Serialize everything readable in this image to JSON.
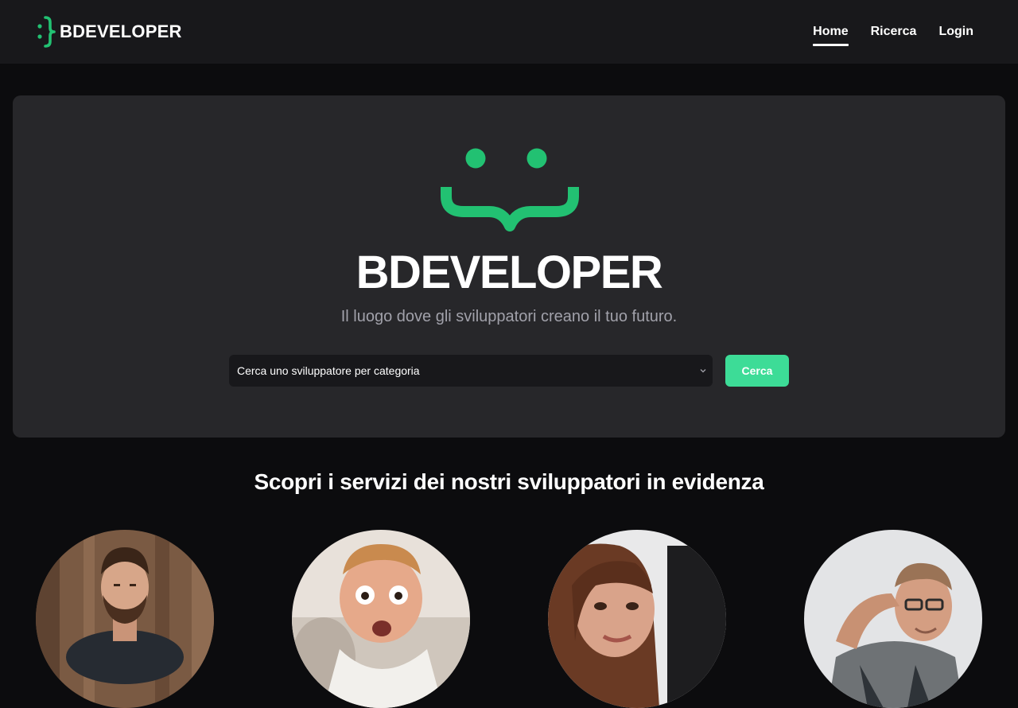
{
  "header": {
    "brand": "BDEVELOPER",
    "nav": [
      {
        "label": "Home",
        "active": true
      },
      {
        "label": "Ricerca",
        "active": false
      },
      {
        "label": "Login",
        "active": false
      }
    ]
  },
  "hero": {
    "title": "BDEVELOPER",
    "subtitle": "Il luogo dove gli sviluppatori creano il tuo futuro.",
    "select_value": "Cerca uno sviluppatore per categoria",
    "search_button": "Cerca"
  },
  "featured": {
    "title": "Scopri i servizi dei nostri sviluppatori in evidenza",
    "developers": [
      {
        "avatar": "man-beard-wood-background"
      },
      {
        "avatar": "man-surprised-face"
      },
      {
        "avatar": "woman-brown-hair"
      },
      {
        "avatar": "man-glasses-tattoo"
      }
    ]
  },
  "colors": {
    "accent": "#22c172",
    "button": "#3ddc97",
    "background": "#0c0c0e",
    "navbar": "#18181b",
    "card": "#27272a",
    "muted_text": "#a1a1aa"
  },
  "icons": {
    "brand": "smiley-brace-logo",
    "select": "chevron-down-icon"
  }
}
